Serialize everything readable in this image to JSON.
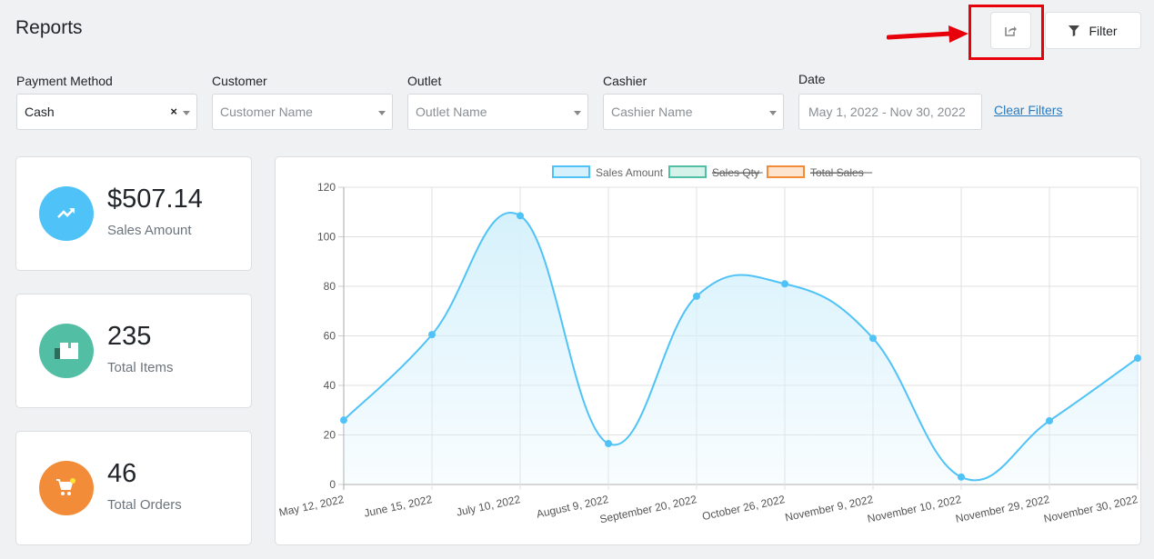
{
  "header": {
    "title": "Reports",
    "export_icon": "share-export-icon",
    "filter_label": "Filter",
    "filter_icon": "funnel-icon"
  },
  "filters": {
    "payment_method": {
      "label": "Payment Method",
      "value": "Cash",
      "clear": "×"
    },
    "customer": {
      "label": "Customer",
      "placeholder": "Customer Name"
    },
    "outlet": {
      "label": "Outlet",
      "placeholder": "Outlet Name"
    },
    "cashier": {
      "label": "Cashier",
      "placeholder": "Cashier Name"
    },
    "date": {
      "label": "Date",
      "value": "May 1, 2022 - Nov 30, 2022"
    },
    "clear_filters": "Clear Filters"
  },
  "stats": [
    {
      "value": "$507.14",
      "label": "Sales Amount",
      "icon": "trending-up-icon",
      "color": "#4fc3f7"
    },
    {
      "value": "235",
      "label": "Total Items",
      "icon": "box-icon",
      "color": "#52bfa5"
    },
    {
      "value": "46",
      "label": "Total Orders",
      "icon": "cart-icon",
      "color": "#f28c38"
    }
  ],
  "chart_data": {
    "type": "line",
    "title": "",
    "xlabel": "",
    "ylabel": "",
    "ylim": [
      0,
      120
    ],
    "yticks": [
      0,
      20,
      40,
      60,
      80,
      100,
      120
    ],
    "grid": true,
    "legend_position": "top",
    "categories": [
      "May 12, 2022",
      "June 15, 2022",
      "July 10, 2022",
      "August 9, 2022",
      "September 20, 2022",
      "October 26, 2022",
      "November 9, 2022",
      "November 10, 2022",
      "November 29, 2022",
      "November 30, 2022"
    ],
    "series": [
      {
        "name": "Sales Amount",
        "values": [
          26,
          60.5,
          108.5,
          16.5,
          76,
          81,
          59,
          3,
          25.7,
          51
        ],
        "color": "#4fc3f7",
        "fill": "#d6f1fc",
        "hidden": false
      },
      {
        "name": "Sales Qty",
        "values": [],
        "color": "#52bfa5",
        "fill": "#d4f1ea",
        "hidden": true
      },
      {
        "name": "Total Sales",
        "values": [],
        "color": "#f28c38",
        "fill": "#fde4cf",
        "hidden": true
      }
    ]
  }
}
